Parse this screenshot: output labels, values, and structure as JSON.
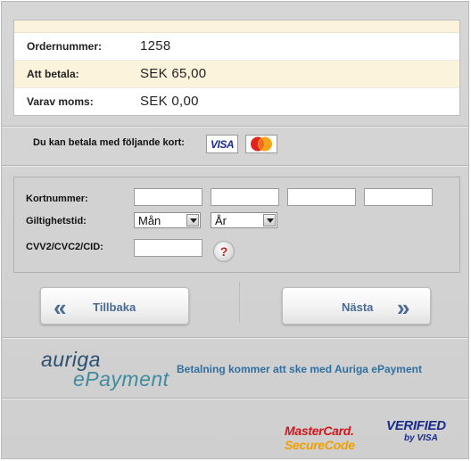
{
  "order": {
    "rows": [
      {
        "label": "Ordernummer:",
        "value": "1258"
      },
      {
        "label": "Att betala:",
        "value": "SEK 65,00"
      },
      {
        "label": "Varav moms:",
        "value": "SEK 0,00"
      }
    ]
  },
  "cards": {
    "text": "Du kan betala med följande kort:",
    "visa_label": "VISA",
    "mastercard_label": "MasterCard"
  },
  "form": {
    "card_number_label": "Kortnummer:",
    "expiry_label": "Giltighetstid:",
    "month_selected": "Mån",
    "year_selected": "År",
    "cvv_label": "CVV2/CVC2/CID:",
    "help_symbol": "?"
  },
  "nav": {
    "back_label": "Tillbaka",
    "next_label": "Nästa",
    "back_arrow": "«",
    "next_arrow": "»"
  },
  "footer": {
    "logo_line1": "auriga",
    "logo_line2": "ePayment",
    "payment_text": "Betalning kommer att ske med Auriga ePayment",
    "mc_securecode_line1": "MasterCard.",
    "mc_securecode_line2": "SecureCode",
    "vbv_line1": "VERIFIED",
    "vbv_line2": "by VISA"
  },
  "colors": {
    "panel": "#d3d3d3",
    "order_highlight": "#fbf3dc",
    "button_text": "#4a6a94",
    "footer_text": "#2f6fa0"
  }
}
